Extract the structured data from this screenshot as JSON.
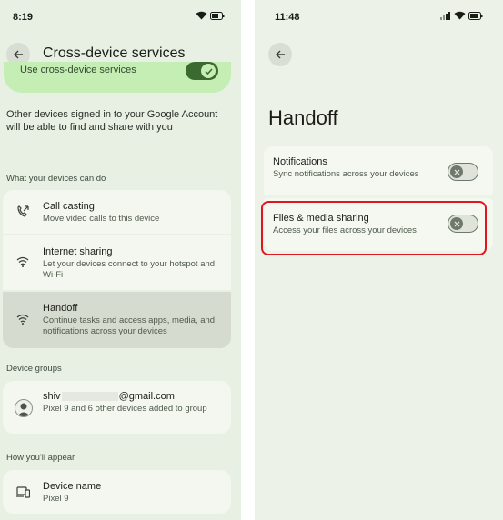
{
  "left": {
    "status_time": "8:19",
    "title": "Cross-device services",
    "toggle_label": "Use cross-device services",
    "description": "Other devices signed in to your Google Account will be able to find and share with you",
    "section_capabilities": "What your devices can do",
    "capabilities": [
      {
        "title": "Call casting",
        "subtitle": "Move video calls to this device",
        "icon": "call-casting-icon"
      },
      {
        "title": "Internet sharing",
        "subtitle": "Let your devices connect to your hotspot and Wi-Fi",
        "icon": "wifi-icon"
      },
      {
        "title": "Handoff",
        "subtitle": "Continue tasks and access apps, media, and notifications across your devices",
        "icon": "wifi-icon"
      }
    ],
    "section_groups": "Device groups",
    "group": {
      "email_prefix": "shiv",
      "email_suffix": "@gmail.com",
      "subtitle": "Pixel 9 and 6 other devices added to group"
    },
    "section_appear": "How you'll appear",
    "device_name": {
      "title": "Device name",
      "value": "Pixel 9"
    }
  },
  "right": {
    "status_time": "11:48",
    "title": "Handoff",
    "items": [
      {
        "title": "Notifications",
        "subtitle": "Sync notifications across your devices",
        "enabled": false
      },
      {
        "title": "Files & media sharing",
        "subtitle": "Access your files across your devices",
        "enabled": false
      }
    ]
  },
  "colors": {
    "highlight": "#e0161f",
    "accent_green": "#3b6a31",
    "toggle_card_green": "#c5eeb5"
  }
}
